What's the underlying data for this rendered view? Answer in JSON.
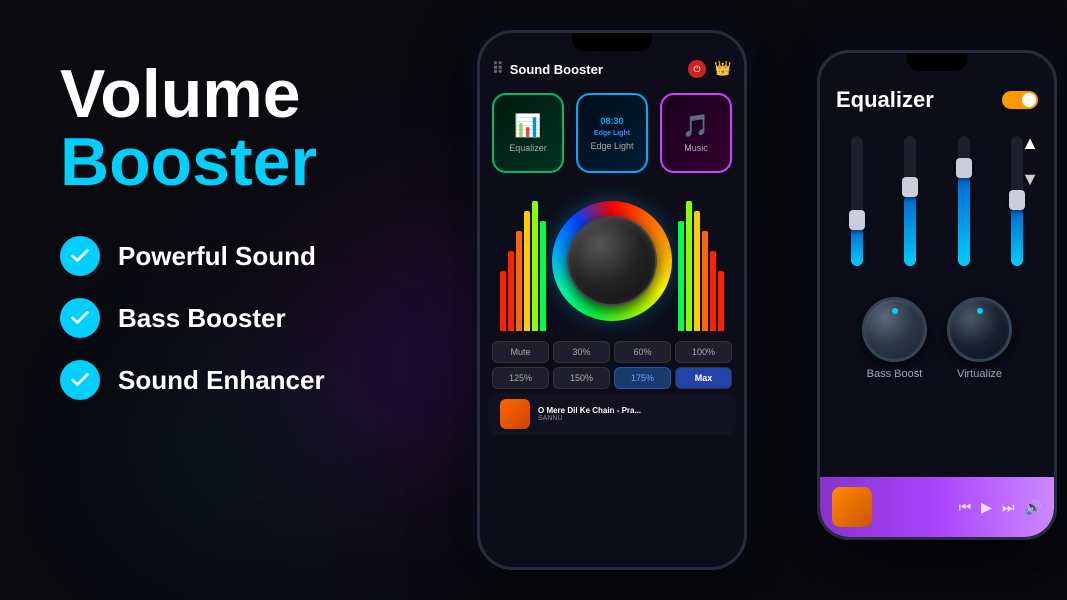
{
  "title": {
    "line1": "Volume",
    "line2": "Booster"
  },
  "features": [
    {
      "id": "powerful-sound",
      "label": "Powerful Sound"
    },
    {
      "id": "bass-booster",
      "label": "Bass Booster"
    },
    {
      "id": "sound-enhancer",
      "label": "Sound Enhancer"
    }
  ],
  "phone1": {
    "app_title": "Sound Booster",
    "cards": [
      {
        "id": "equalizer",
        "label": "Equalizer",
        "icon": "📊",
        "border_color": "#00bb66"
      },
      {
        "id": "edge-light",
        "label": "Edge Light",
        "icon": "🕐",
        "time": "08:30",
        "border_color": "#00aaff"
      },
      {
        "id": "music",
        "label": "Music",
        "icon": "🎵",
        "border_color": "#cc44ff"
      }
    ],
    "volume_buttons": [
      {
        "label": "Mute",
        "active": false
      },
      {
        "label": "30%",
        "active": false
      },
      {
        "label": "60%",
        "active": false
      },
      {
        "label": "100%",
        "active": false
      },
      {
        "label": "125%",
        "active": false
      },
      {
        "label": "150%",
        "active": false
      },
      {
        "label": "175%",
        "active": false
      },
      {
        "label": "Max",
        "active": true,
        "style": "max"
      }
    ],
    "now_playing": {
      "title": "O Mere Dil Ke Chain - Pra...",
      "artist": "SANNU"
    }
  },
  "phone2": {
    "title": "Equalizer",
    "knobs": [
      {
        "id": "bass-boost",
        "label": "Bass Boost"
      },
      {
        "id": "virtualize",
        "label": "Virtualize"
      }
    ],
    "sliders": [
      {
        "fill_pct": 30,
        "thumb_pct": 30
      },
      {
        "fill_pct": 55,
        "thumb_pct": 55
      },
      {
        "fill_pct": 70,
        "thumb_pct": 70
      },
      {
        "fill_pct": 45,
        "thumb_pct": 45
      }
    ]
  },
  "colors": {
    "accent_cyan": "#00cfff",
    "bg_dark": "#0a0a0f",
    "white": "#ffffff"
  }
}
